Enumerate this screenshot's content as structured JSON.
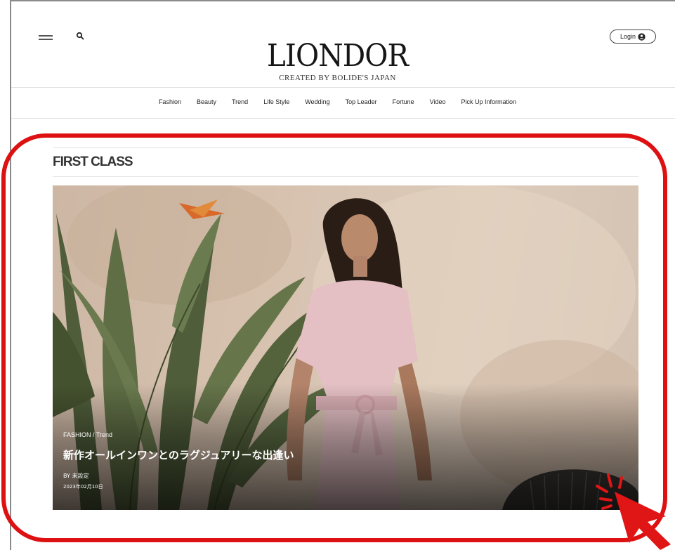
{
  "header": {
    "logo_title": "LIONDOR",
    "logo_subtitle": "CREATED BY BOLIDE'S JAPAN",
    "login_label": "Login"
  },
  "nav": {
    "items": [
      "Fashion",
      "Beauty",
      "Trend",
      "Life Style",
      "Wedding",
      "Top Leader",
      "Fortune",
      "Video",
      "Pick Up Information"
    ]
  },
  "section": {
    "title": "FIRST CLASS"
  },
  "hero": {
    "category": "FASHION",
    "category_separator": " / ",
    "subcategory": "Trend",
    "headline": "新作オールインワンとのラグジュアリーな出逢い",
    "author": "BY 未設定",
    "date": "2023年02月10日"
  },
  "colors": {
    "highlight": "#dd1111",
    "cursor": "#e01515"
  },
  "icons": [
    "menu-icon",
    "search-icon",
    "user-icon",
    "cursor-arrow-icon"
  ]
}
